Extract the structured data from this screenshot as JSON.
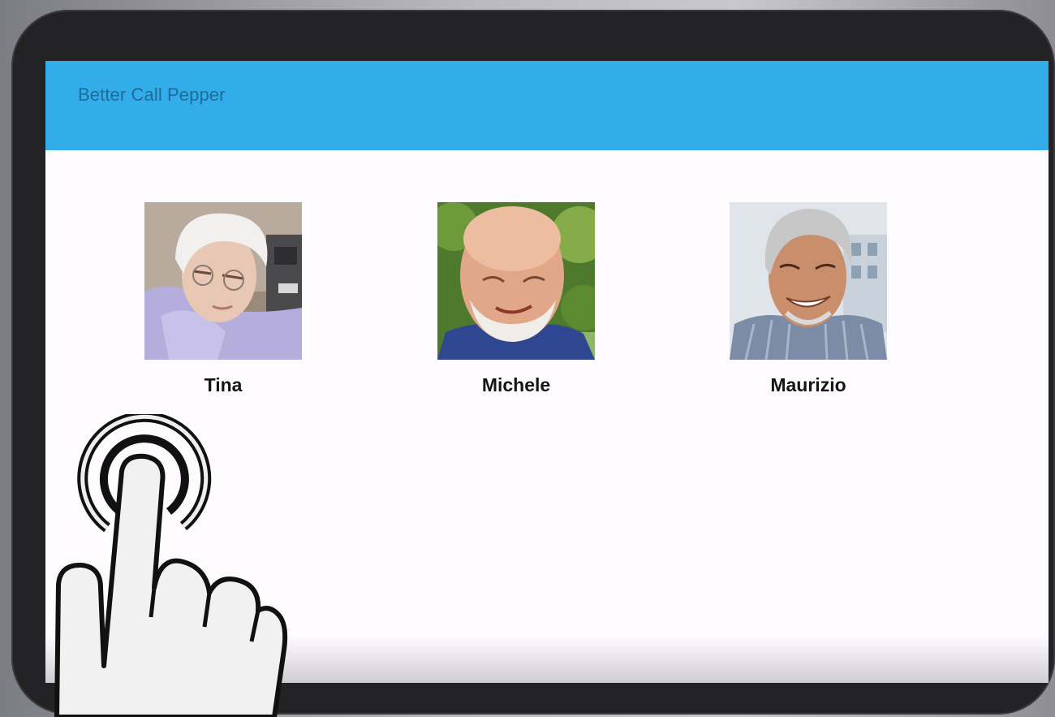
{
  "app": {
    "title": "Better Call Pepper"
  },
  "contacts": [
    {
      "name": "Tina",
      "avatar_icon": "elderly-woman-photo"
    },
    {
      "name": "Michele",
      "avatar_icon": "bald-bearded-man-photo"
    },
    {
      "name": "Maurizio",
      "avatar_icon": "grey-haired-smiling-man-photo"
    }
  ],
  "overlay": {
    "icon": "tap-gesture-icon"
  },
  "colors": {
    "appbar": "#33adea",
    "title_text": "#1e6c98",
    "screen_bg": "#fdfbfd",
    "bezel": "#232325"
  }
}
